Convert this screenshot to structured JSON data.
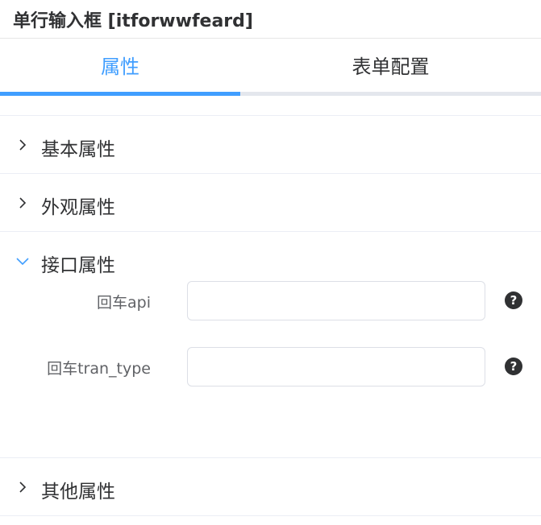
{
  "panel": {
    "title": "单行输入框 [itforwwfeard]"
  },
  "tabs": [
    {
      "label": "属性",
      "active": true
    },
    {
      "label": "表单配置",
      "active": false
    }
  ],
  "colors": {
    "accent": "#409eff",
    "text": "#303133",
    "muted": "#606266",
    "border": "#dcdfe6"
  },
  "sections": [
    {
      "label": "基本属性",
      "expanded": false,
      "icon": "chevron-right-icon"
    },
    {
      "label": "外观属性",
      "expanded": false,
      "icon": "chevron-right-icon"
    },
    {
      "label": "接口属性",
      "expanded": true,
      "icon": "chevron-down-icon",
      "fields": [
        {
          "label": "回车api",
          "value": "",
          "placeholder": "",
          "help_icon": "question-circle-icon"
        },
        {
          "label": "回车tran_type",
          "value": "",
          "placeholder": "",
          "help_icon": "question-circle-icon"
        }
      ]
    },
    {
      "label": "其他属性",
      "expanded": false,
      "icon": "chevron-right-icon"
    }
  ],
  "help_glyph": "?"
}
